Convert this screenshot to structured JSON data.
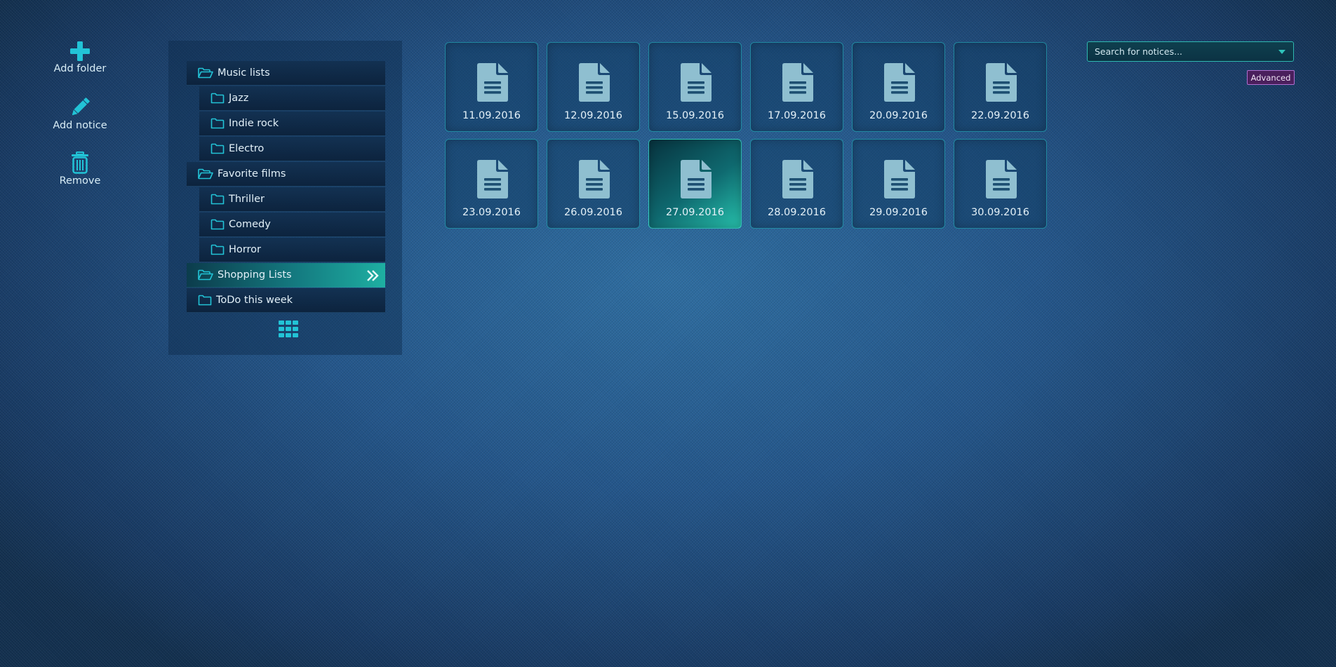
{
  "toolbar": {
    "add_folder": {
      "label": "Add folder",
      "icon": "plus-icon"
    },
    "add_notice": {
      "label": "Add notice",
      "icon": "pencil-icon"
    },
    "remove": {
      "label": "Remove",
      "icon": "trash-icon"
    }
  },
  "folders": [
    {
      "label": "Music lists",
      "level": 0,
      "open": true
    },
    {
      "label": "Jazz",
      "level": 1
    },
    {
      "label": "Indie rock",
      "level": 1
    },
    {
      "label": "Electro",
      "level": 1
    },
    {
      "label": "Favorite films",
      "level": 0,
      "open": true
    },
    {
      "label": "Thriller",
      "level": 1
    },
    {
      "label": "Comedy",
      "level": 1
    },
    {
      "label": "Horror",
      "level": 1
    },
    {
      "label": "Shopping Lists",
      "level": 0,
      "open": true,
      "active": true
    },
    {
      "label": "ToDo this week",
      "level": 0
    }
  ],
  "notices": [
    {
      "date": "11.09.2016"
    },
    {
      "date": "12.09.2016"
    },
    {
      "date": "15.09.2016"
    },
    {
      "date": "17.09.2016"
    },
    {
      "date": "20.09.2016"
    },
    {
      "date": "22.09.2016"
    },
    {
      "date": "23.09.2016"
    },
    {
      "date": "26.09.2016"
    },
    {
      "date": "27.09.2016",
      "selected": true
    },
    {
      "date": "28.09.2016"
    },
    {
      "date": "29.09.2016"
    },
    {
      "date": "30.09.2016"
    }
  ],
  "search": {
    "placeholder": "Search for notices...",
    "value": ""
  },
  "advanced_button": {
    "label": "Advanced"
  },
  "colors": {
    "accent": "#22c3d6",
    "active_item": "#1eafa2",
    "advanced_bg": "#4a1f5c"
  }
}
